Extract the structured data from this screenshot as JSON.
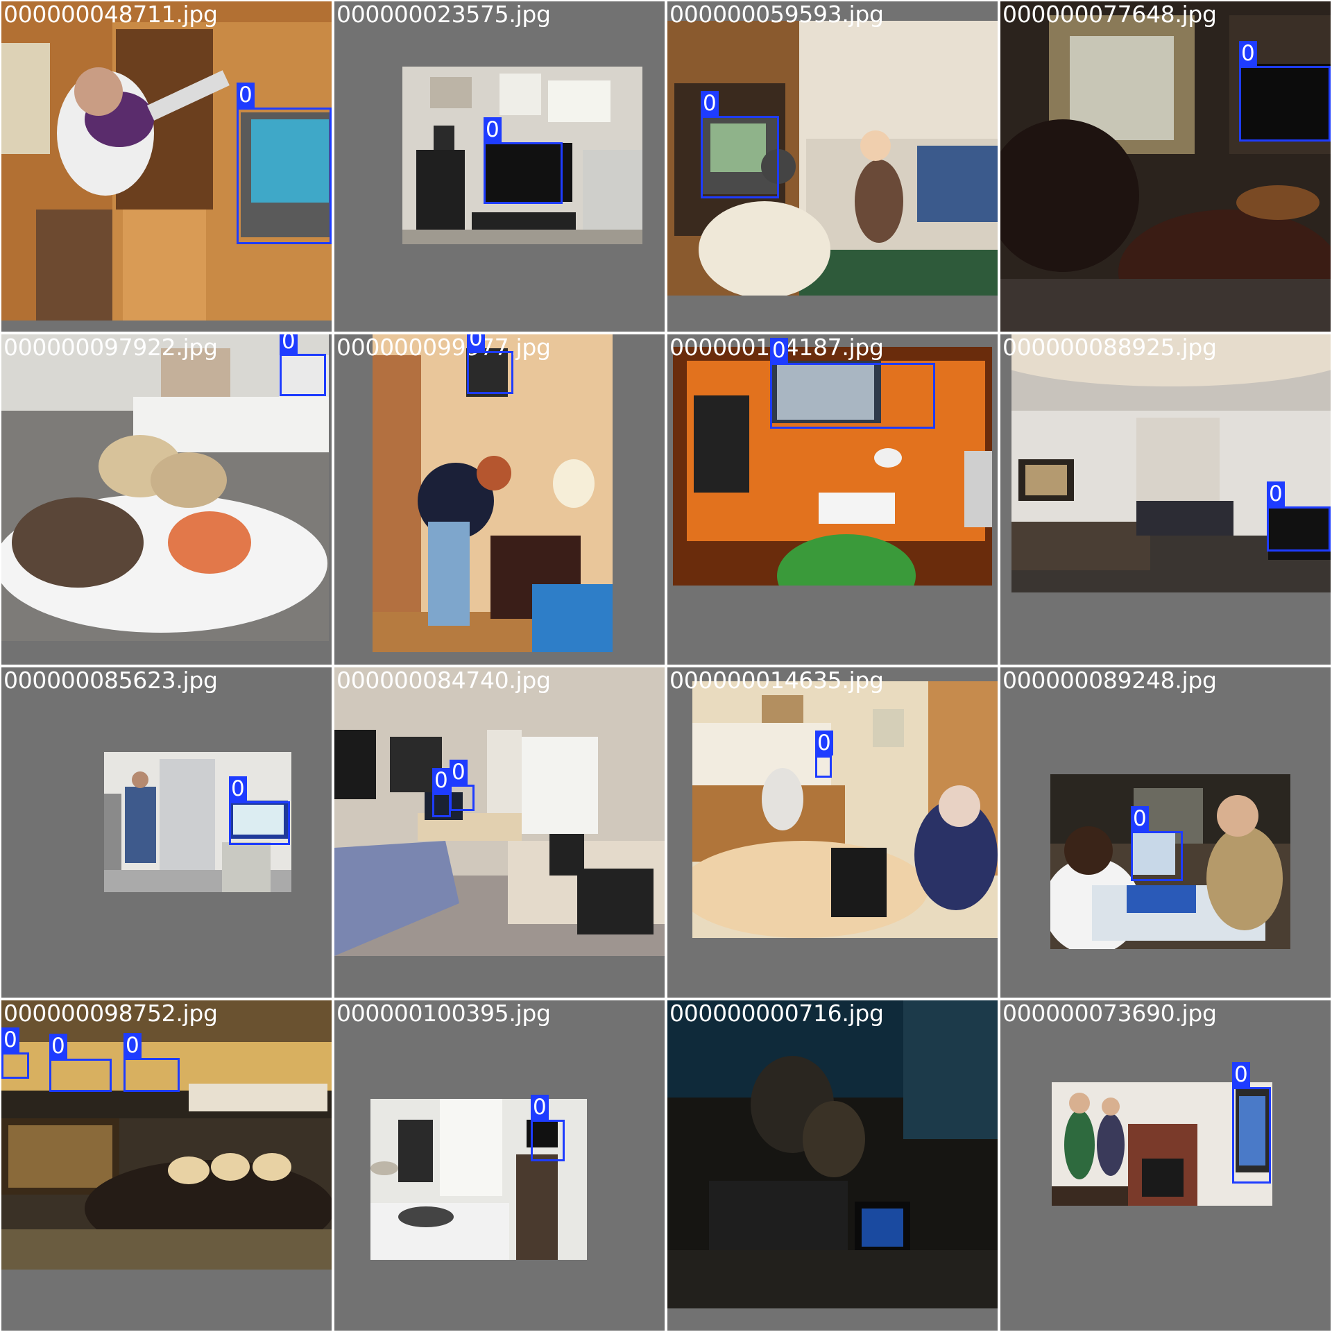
{
  "grid": {
    "columns": 4,
    "rows": 4,
    "background": "#727272",
    "box_color": "#1e3cff",
    "tiles": [
      {
        "filename": "000000048711.jpg",
        "scene": "man-playing-wii",
        "boxes": [
          {
            "label": "0"
          }
        ]
      },
      {
        "filename": "000000023575.jpg",
        "scene": "office-desk-monitor",
        "boxes": [
          {
            "label": "0"
          }
        ]
      },
      {
        "filename": "000000059593.jpg",
        "scene": "family-living-room-tv",
        "boxes": [
          {
            "label": "0"
          }
        ]
      },
      {
        "filename": "000000077648.jpg",
        "scene": "dark-leather-sofa-room",
        "boxes": [
          {
            "label": "0"
          }
        ]
      },
      {
        "filename": "000000097922.jpg",
        "scene": "dinner-plate-keyboard",
        "boxes": [
          {
            "label": "0"
          }
        ]
      },
      {
        "filename": "000000099977.jpg",
        "scene": "bedroom-person-desk",
        "boxes": [
          {
            "label": "0"
          }
        ]
      },
      {
        "filename": "000000104187.jpg",
        "scene": "orange-desk-imac",
        "boxes": [
          {
            "label": "0"
          }
        ]
      },
      {
        "filename": "000000088925.jpg",
        "scene": "modern-living-room",
        "boxes": [
          {
            "label": "0"
          }
        ]
      },
      {
        "filename": "000000085623.jpg",
        "scene": "office-people-screen",
        "boxes": [
          {
            "label": "0"
          }
        ]
      },
      {
        "filename": "000000084740.jpg",
        "scene": "bedroom-computer-desk",
        "boxes": [
          {
            "label": "0"
          },
          {
            "label": "0"
          }
        ]
      },
      {
        "filename": "000000014635.jpg",
        "scene": "kitchen-elderly-woman",
        "boxes": [
          {
            "label": "0"
          }
        ]
      },
      {
        "filename": "000000089248.jpg",
        "scene": "two-people-laptop",
        "boxes": [
          {
            "label": "0"
          }
        ]
      },
      {
        "filename": "000000098752.jpg",
        "scene": "retro-living-room-tvs",
        "boxes": [
          {
            "label": "0"
          },
          {
            "label": "0"
          },
          {
            "label": "0"
          }
        ]
      },
      {
        "filename": "000000100395.jpg",
        "scene": "hotel-bedroom-tv",
        "boxes": [
          {
            "label": "0"
          }
        ]
      },
      {
        "filename": "000000000716.jpg",
        "scene": "dark-room-laptop",
        "boxes": []
      },
      {
        "filename": "000000073690.jpg",
        "scene": "couple-playing-wii",
        "boxes": [
          {
            "label": "0"
          }
        ]
      }
    ]
  }
}
